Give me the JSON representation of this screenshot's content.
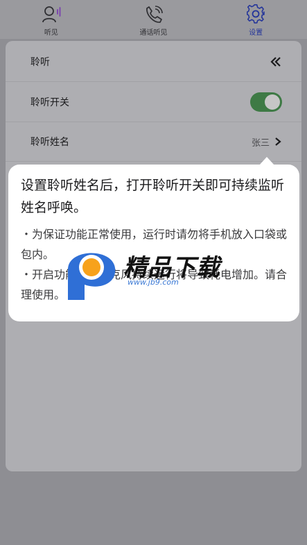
{
  "tabs": [
    {
      "label": "听见",
      "icon": "person-voice-icon",
      "active": false
    },
    {
      "label": "通话听见",
      "icon": "phone-call-icon",
      "active": false
    },
    {
      "label": "设置",
      "icon": "gear-icon",
      "active": true
    }
  ],
  "settings": {
    "section_title": "聆听",
    "collapse_icon": "double-chevron-left-icon",
    "toggle_label": "聆听开关",
    "toggle_on": true,
    "name_label": "聆听姓名",
    "name_value": "张三"
  },
  "tooltip": {
    "main": "设置聆听姓名后，打开聆听开关即可持续监听姓名呼唤。",
    "bullet1": "・为保证功能正常使用，运行时请勿将手机放入口袋或包内。",
    "bullet2": "・开启功能后，麦克风持续运行将导致耗电增加。请合理使用。"
  },
  "watermark": {
    "title": "精品下载",
    "url": "www.jb9.com"
  },
  "colors": {
    "accent": "#24359a",
    "toggle_on": "#3e7a45",
    "watermark_blue": "#2f6fd6",
    "watermark_orange": "#f7a21c"
  }
}
